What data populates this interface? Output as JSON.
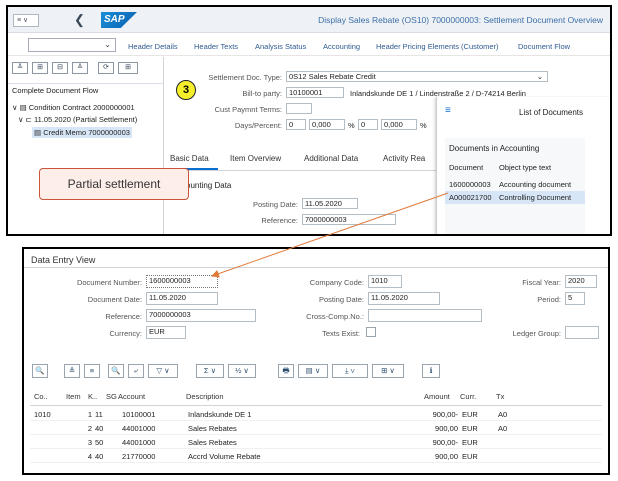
{
  "top": {
    "menu_label": "≡ ∨",
    "back_icon": "chevron-left-icon",
    "logo": "SAP",
    "window_title": "Display Sales Rebate (OS10) 7000000003: Settlement Document Overview",
    "toolbar": [
      "Header Details",
      "Header Texts",
      "Analysis Status",
      "Accounting",
      "Header Pricing Elements (Customer)",
      "Document Flow"
    ],
    "tree_buttons": [
      "≚",
      "⊞",
      "⊟",
      "≙",
      "⟳",
      "⊞"
    ],
    "doc_flow_title": "Complete Document Flow",
    "tree": [
      {
        "label": "Condition Contract 2000000001"
      },
      {
        "label": "11.05.2020 (Partial Settlement)"
      },
      {
        "label": "Credit Memo 7000000003"
      }
    ],
    "step": "3",
    "fields": {
      "settlement_type_label": "Settlement Doc. Type:",
      "settlement_type_value": "0S12 Sales Rebate Credit",
      "billto_label": "Bill-to party:",
      "billto_value": "10100001",
      "billto_text": "Inlandskunde DE 1 / Lindenstraße 2 / D-74214 Berlin",
      "terms_label": "Cust Paymnt Terms:",
      "terms_value": "",
      "days_label": "Days/Percent:",
      "d1": "0",
      "p1": "0,000",
      "pc1": "%",
      "d2": "0",
      "p2": "0,000",
      "pc2": "%"
    },
    "tabs": [
      "Basic Data",
      "Item Overview",
      "Additional Data",
      "Activity Rea"
    ],
    "billing_date_fragment": "ounting Data",
    "posting_date_label": "Posting Date:",
    "posting_date_value": "11.05.2020",
    "reference_label": "Reference:",
    "reference_value": "7000000003",
    "popup_title": "List of Documents",
    "docs_header": "Documents in Accounting",
    "docs_cols": [
      "Document",
      "Object type text"
    ],
    "docs_rows": [
      {
        "doc": "1600000003",
        "type": "Accounting document"
      },
      {
        "doc": "A000021700",
        "type": "Controlling Document"
      }
    ],
    "callout": "Partial settlement"
  },
  "bottom": {
    "title": "Data Entry View",
    "doc_number_label": "Document Number:",
    "doc_number_value": "1600000003",
    "company_code_label": "Company Code:",
    "company_code_value": "1010",
    "fiscal_year_label": "Fiscal Year:",
    "fiscal_year_value": "2020",
    "doc_date_label": "Document Date:",
    "doc_date_value": "11.05.2020",
    "posting_date_label": "Posting Date:",
    "posting_date_value": "11.05.2020",
    "period_label": "Period:",
    "period_value": "5",
    "reference_label": "Reference:",
    "reference_value": "7000000003",
    "crosscomp_label": "Cross-Comp.No.:",
    "crosscomp_value": "",
    "currency_label": "Currency:",
    "currency_value": "EUR",
    "texts_exist_label": "Texts Exist:",
    "ledger_group_label": "Ledger Group:",
    "ledger_group_value": "",
    "tools": [
      "🔍",
      "≜",
      "≡",
      "🔍",
      "⤶",
      "▽ ∨",
      "Σ ∨",
      "½ ∨",
      "🖶",
      "▤ ∨",
      "⤓ ∨",
      "⊞ ∨",
      "ℹ"
    ],
    "columns": [
      "Co..",
      "Item",
      "K..",
      "SG",
      "Account",
      "Description",
      "Amount",
      "Curr.",
      "Tx"
    ],
    "rows": [
      {
        "co": "1010",
        "item": "1",
        "k": "11",
        "acct": "10100001",
        "desc": "Inlandskunde DE 1",
        "amt": "900,00-",
        "cur": "EUR",
        "tx": "A0"
      },
      {
        "co": "",
        "item": "2",
        "k": "40",
        "acct": "44001000",
        "desc": "Sales Rebates",
        "amt": "900,00",
        "cur": "EUR",
        "tx": "A0"
      },
      {
        "co": "",
        "item": "3",
        "k": "50",
        "acct": "44001000",
        "desc": "Sales Rebates",
        "amt": "900,00-",
        "cur": "EUR",
        "tx": ""
      },
      {
        "co": "",
        "item": "4",
        "k": "40",
        "acct": "21770000",
        "desc": "Accrd Volume Rebate",
        "amt": "900,00",
        "cur": "EUR",
        "tx": ""
      }
    ]
  },
  "colors": {
    "accent": "#0a6ed1",
    "callout_border": "#c8553a",
    "arrow": "#e07a3a",
    "badge": "#f4ef2a"
  }
}
